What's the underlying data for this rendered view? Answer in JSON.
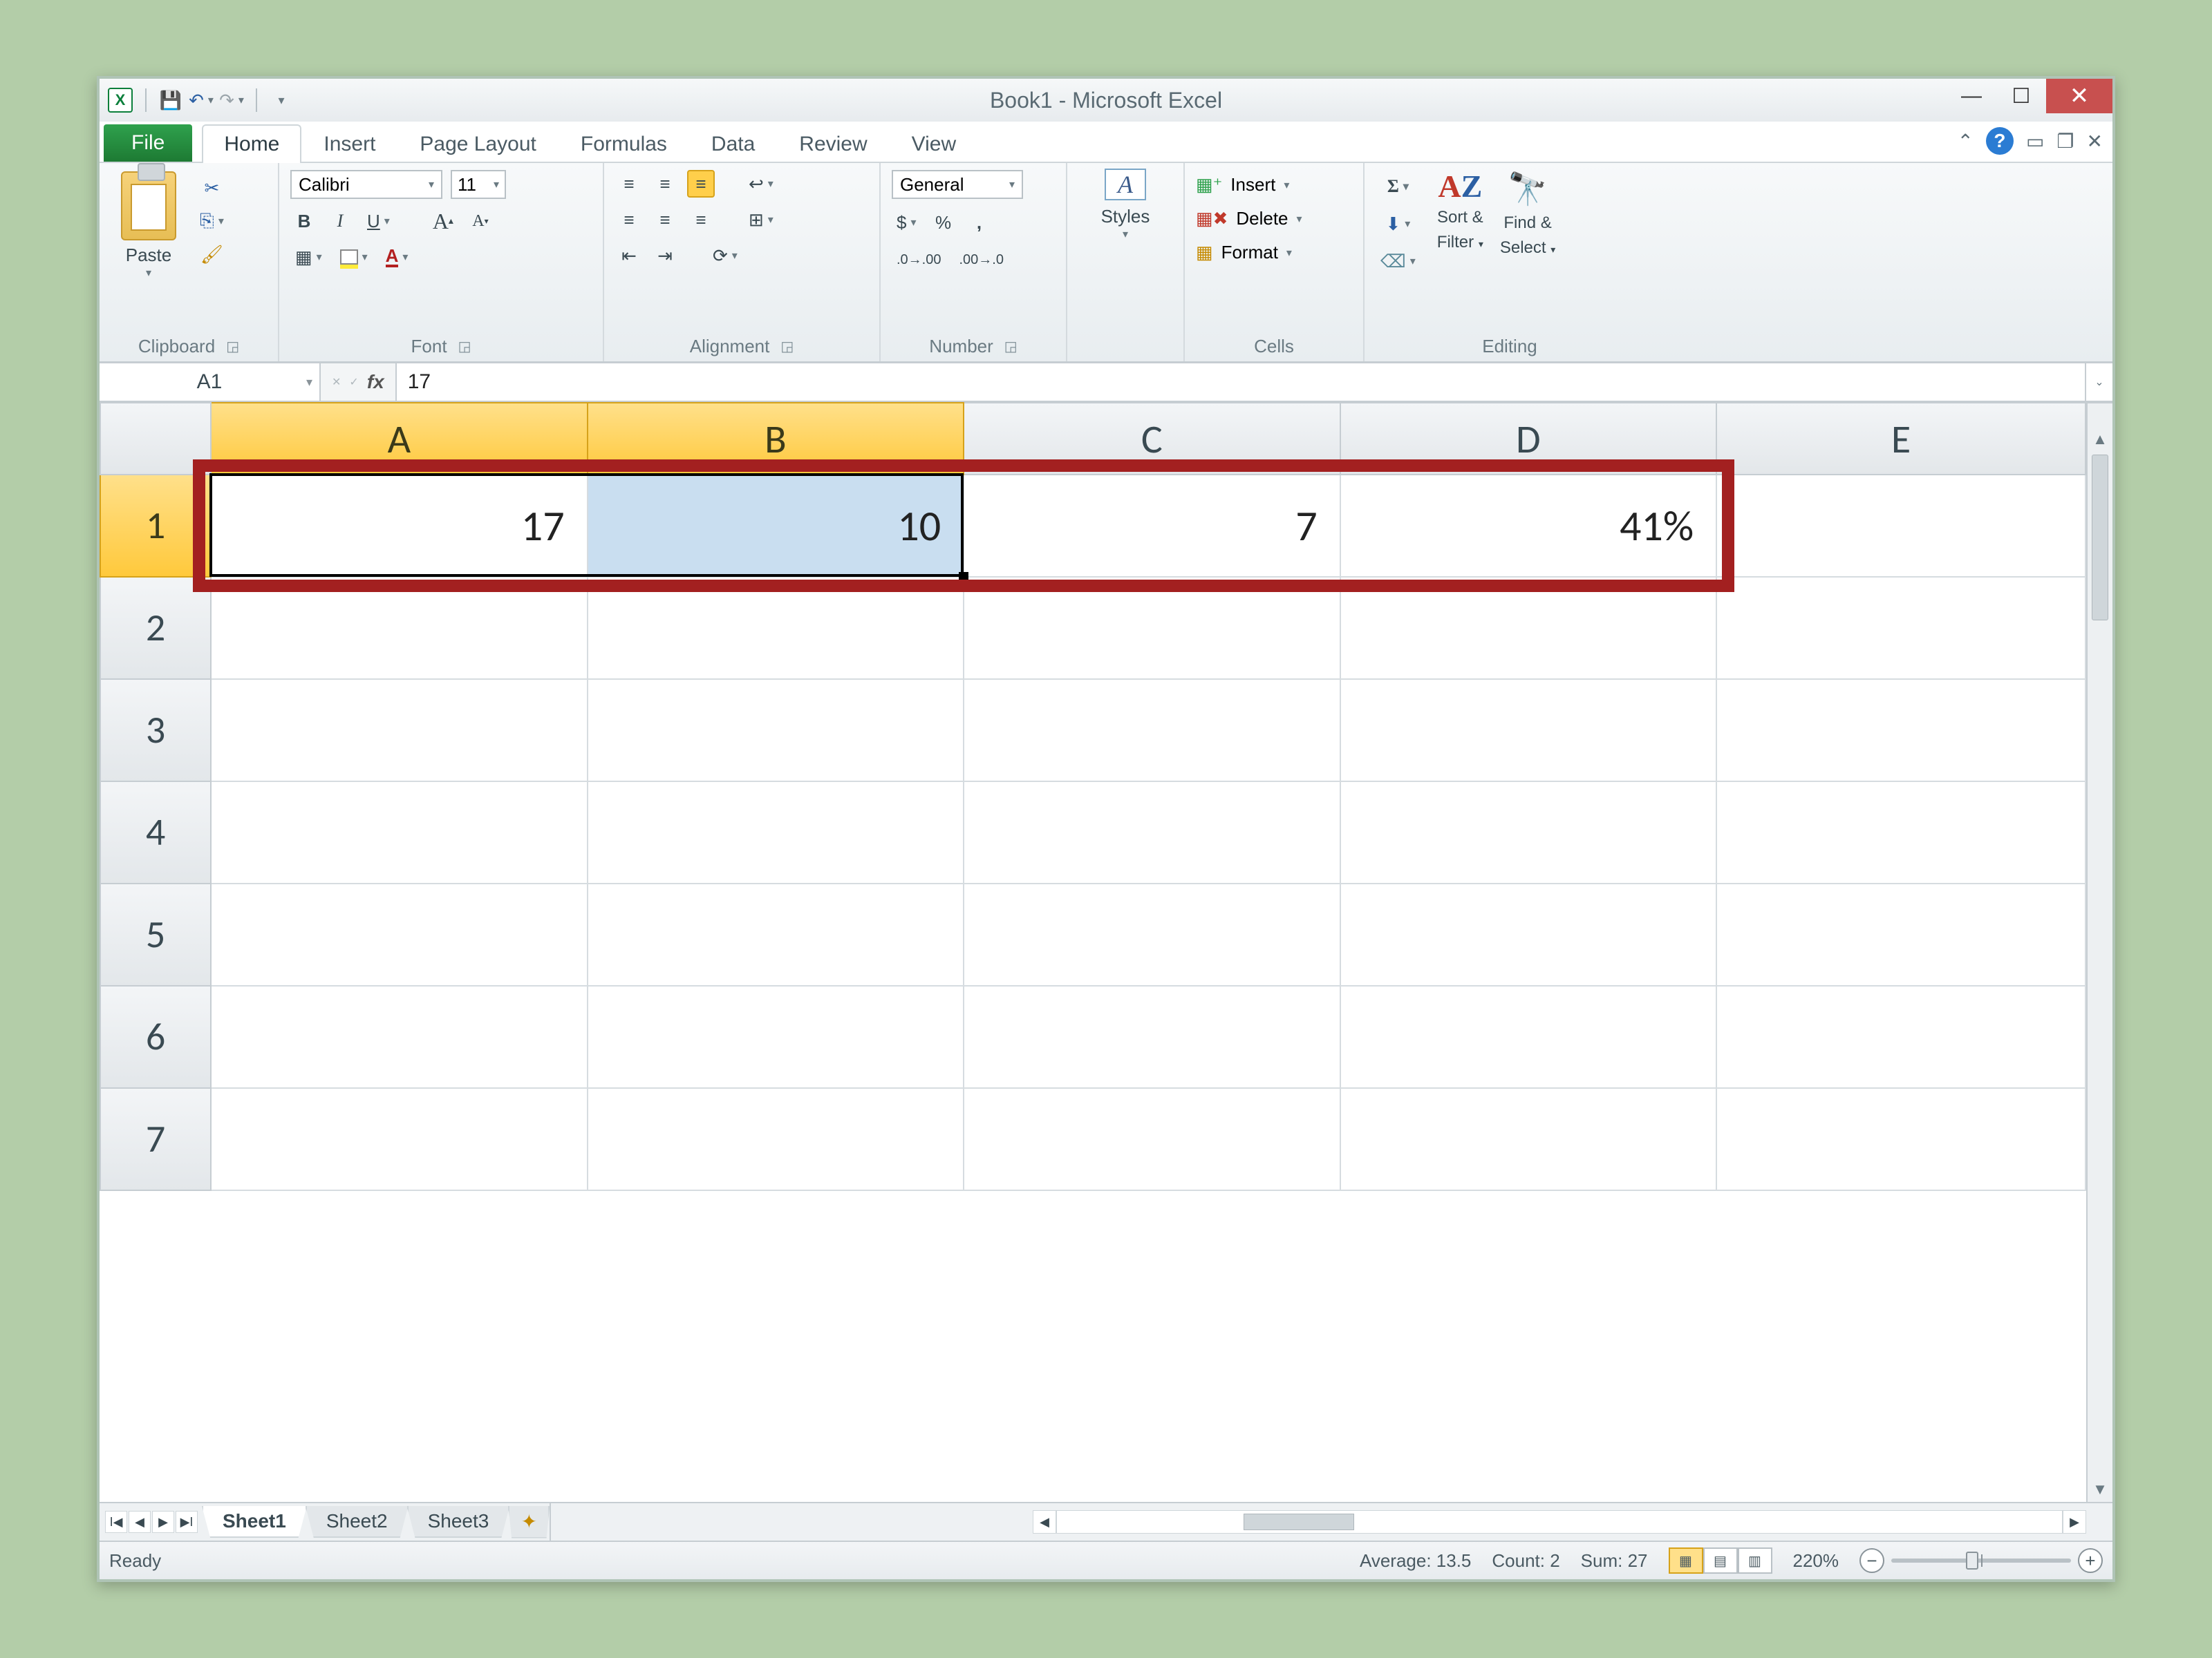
{
  "window": {
    "title": "Book1 - Microsoft Excel"
  },
  "qat": {
    "save": "💾",
    "undo": "↶",
    "redo": "↷"
  },
  "tabs": {
    "file": "File",
    "items": [
      "Home",
      "Insert",
      "Page Layout",
      "Formulas",
      "Data",
      "Review",
      "View"
    ],
    "active": "Home"
  },
  "ribbon": {
    "clipboard": {
      "paste": "Paste",
      "label": "Clipboard"
    },
    "font": {
      "name": "Calibri",
      "size": "11",
      "bold": "B",
      "italic": "I",
      "underline": "U",
      "grow": "A",
      "shrink": "A",
      "label": "Font"
    },
    "alignment": {
      "label": "Alignment"
    },
    "number": {
      "format": "General",
      "label": "Number"
    },
    "styles": {
      "label": "Styles"
    },
    "cells": {
      "insert": "Insert",
      "delete": "Delete",
      "format": "Format",
      "label": "Cells"
    },
    "editing": {
      "sort": "Sort &",
      "sort2": "Filter",
      "find": "Find &",
      "find2": "Select",
      "label": "Editing"
    }
  },
  "formula_bar": {
    "name_box": "A1",
    "fx": "fx",
    "value": "17"
  },
  "columns": [
    "A",
    "B",
    "C",
    "D",
    "E"
  ],
  "rows": [
    "1",
    "2",
    "3",
    "4",
    "5",
    "6",
    "7"
  ],
  "cells": {
    "A1": "17",
    "B1": "10",
    "C1": "7",
    "D1": "41%"
  },
  "sheets": {
    "s1": "Sheet1",
    "s2": "Sheet2",
    "s3": "Sheet3"
  },
  "status": {
    "ready": "Ready",
    "average": "Average: 13.5",
    "count": "Count: 2",
    "sum": "Sum: 27",
    "zoom": "220%"
  }
}
